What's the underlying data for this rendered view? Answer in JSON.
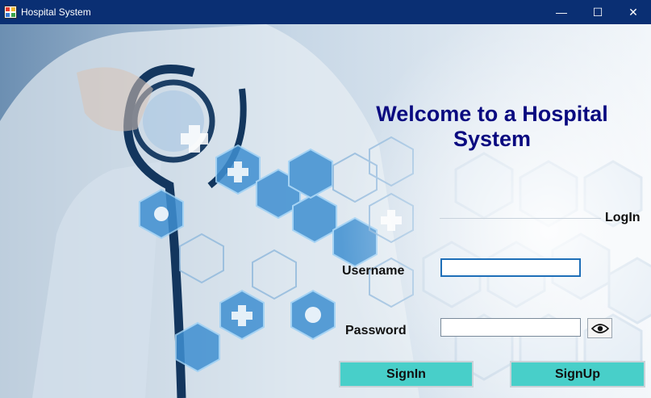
{
  "window": {
    "title": "Hospital System",
    "icon": "app-window-icon",
    "controls": [
      "minimize-icon",
      "maximize-icon",
      "close-icon"
    ],
    "controls_glyphs": {
      "minimize": "—",
      "maximize": "☐",
      "close": "✕"
    }
  },
  "main": {
    "welcome_line1": "Welcome to a Hospital",
    "welcome_line2": "System",
    "section_label": "LogIn",
    "username_label": "Username",
    "username_value": "",
    "password_label": "Password",
    "password_value": "",
    "show_password_icon": "eye-icon",
    "signin_label": "SignIn",
    "signup_label": "SignUp"
  },
  "colors": {
    "titlebar": "#0a2f73",
    "welcome_text": "#0a0a80",
    "button": "#48cfc9"
  }
}
